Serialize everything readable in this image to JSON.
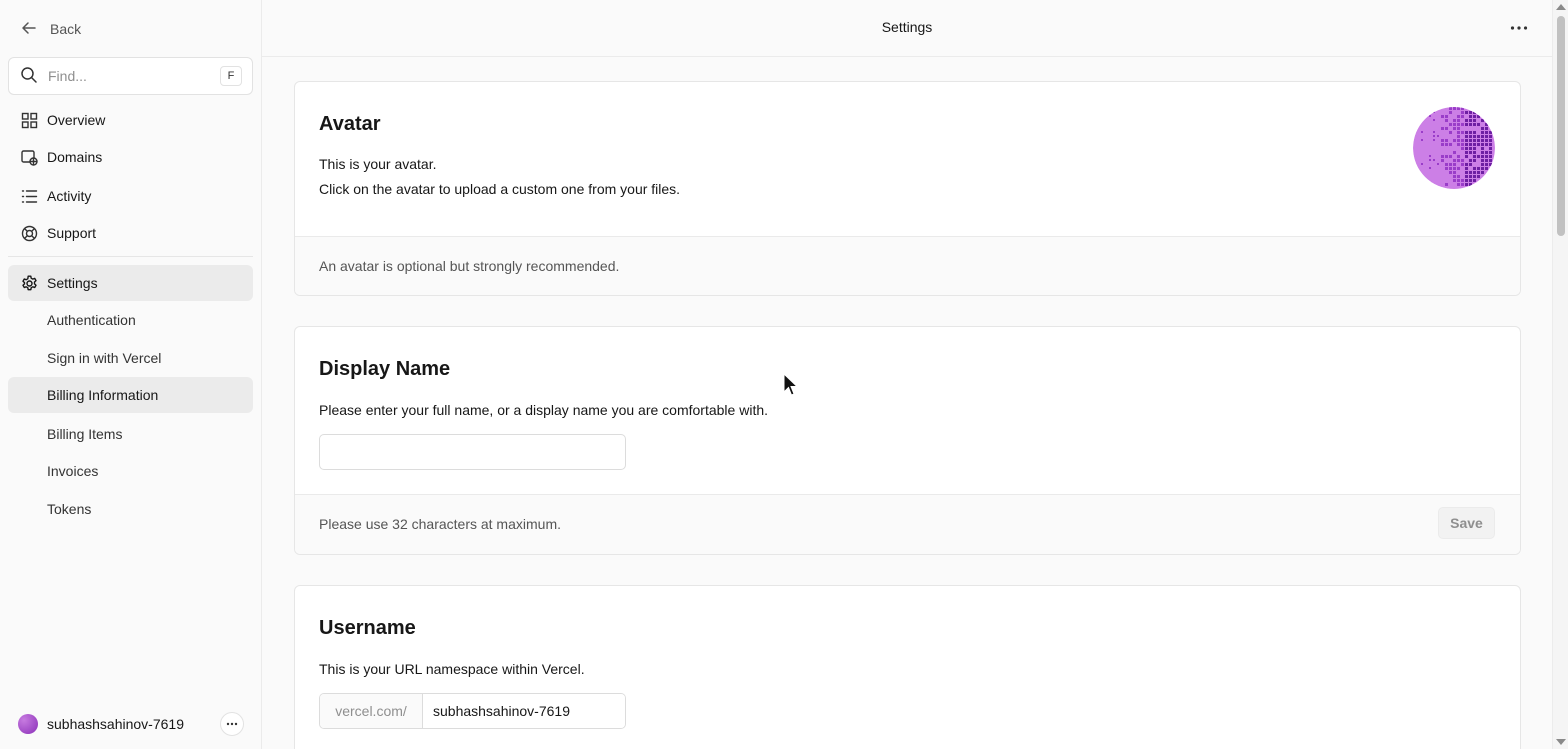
{
  "sidebar": {
    "back_label": "Back",
    "search": {
      "placeholder": "Find...",
      "shortcut": "F"
    },
    "items": [
      {
        "label": "Overview",
        "icon": "grid-icon"
      },
      {
        "label": "Domains",
        "icon": "globe-window-icon"
      },
      {
        "label": "Activity",
        "icon": "list-icon"
      },
      {
        "label": "Support",
        "icon": "lifebuoy-icon"
      },
      {
        "label": "Settings",
        "icon": "gear-icon",
        "active": true
      }
    ],
    "sub_items": [
      {
        "label": "Authentication"
      },
      {
        "label": "Sign in with Vercel"
      },
      {
        "label": "Billing Information",
        "active": true
      },
      {
        "label": "Billing Items"
      },
      {
        "label": "Invoices"
      },
      {
        "label": "Tokens"
      }
    ],
    "user": {
      "name": "subhashsahinov-7619"
    }
  },
  "header": {
    "title": "Settings"
  },
  "avatar_card": {
    "title": "Avatar",
    "line1": "This is your avatar.",
    "line2": "Click on the avatar to upload a custom one from your files.",
    "footer_note": "An avatar is optional but strongly recommended."
  },
  "display_name_card": {
    "title": "Display Name",
    "description": "Please enter your full name, or a display name you are comfortable with.",
    "input_value": "",
    "footer_note": "Please use 32 characters at maximum.",
    "save_label": "Save"
  },
  "username_card": {
    "title": "Username",
    "description": "This is your URL namespace within Vercel.",
    "prefix": "vercel.com/",
    "input_value": "subhashsahinov-7619"
  },
  "colors": {
    "accent_avatar": "#a93fd6",
    "active_bg": "#ebebeb"
  }
}
